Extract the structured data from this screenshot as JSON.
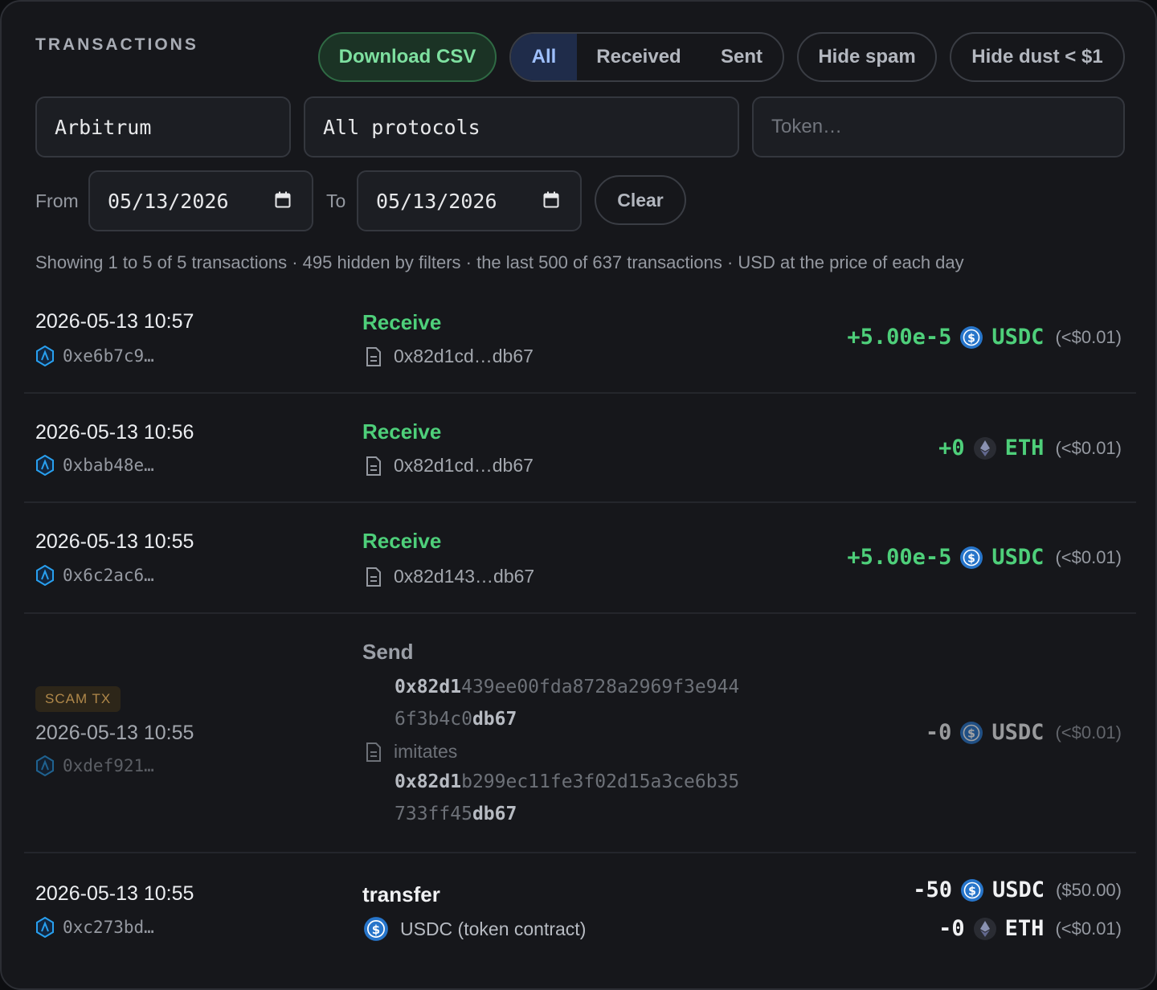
{
  "header": {
    "title": "TRANSACTIONS",
    "download_label": "Download CSV",
    "filter_tabs": [
      "All",
      "Received",
      "Sent"
    ],
    "hide_spam_label": "Hide spam",
    "hide_dust_label": "Hide dust < $1"
  },
  "filters": {
    "chain_value": "Arbitrum",
    "protocol_value": "All protocols",
    "token_placeholder": "Token…",
    "from_label": "From",
    "from_value": "05/13/2026",
    "to_label": "To",
    "to_value": "05/13/2026",
    "clear_label": "Clear"
  },
  "summary": "Showing 1 to 5 of 5 transactions · 495 hidden by filters · the last 500 of 637 transactions · USD at the price of each day",
  "colors": {
    "accent_green": "#4ecf7a",
    "accent_blue": "#9fc0ff",
    "scam": "#b0884a",
    "usdc": "#2775ca"
  },
  "transactions": [
    {
      "time": "2026-05-13 10:57",
      "hash": "0xe6b7c9…",
      "kind": "Receive",
      "counterparty": "0x82d1cd…db67",
      "amounts": [
        {
          "value": "+5.00e-5",
          "token": "USDC",
          "icon": "usdc-icon",
          "usd": "(<$0.01)"
        }
      ]
    },
    {
      "time": "2026-05-13 10:56",
      "hash": "0xbab48e…",
      "kind": "Receive",
      "counterparty": "0x82d1cd…db67",
      "amounts": [
        {
          "value": "+0",
          "token": "ETH",
          "icon": "eth-icon",
          "usd": "(<$0.01)"
        }
      ]
    },
    {
      "time": "2026-05-13 10:55",
      "hash": "0x6c2ac6…",
      "kind": "Receive",
      "counterparty": "0x82d143…db67",
      "amounts": [
        {
          "value": "+5.00e-5",
          "token": "USDC",
          "icon": "usdc-icon",
          "usd": "(<$0.01)"
        }
      ]
    },
    {
      "time": "2026-05-13 10:55",
      "hash": "0xdef921…",
      "kind": "Send",
      "badge": "SCAM TX",
      "scam_address": {
        "line1_bold": "0x82d1",
        "line1_rest": "439ee00fda8728a2969f3e944",
        "line2_rest": "6f3b4c0",
        "line2_bold": "db67"
      },
      "imitates_label": "imitates",
      "real_address": {
        "line1_bold": "0x82d1",
        "line1_rest": "b299ec11fe3f02d15a3ce6b35",
        "line2_rest": "733ff45",
        "line2_bold": "db67"
      },
      "amounts": [
        {
          "value": "-0",
          "token": "USDC",
          "icon": "usdc-icon",
          "usd": "(<$0.01)"
        }
      ]
    },
    {
      "time": "2026-05-13 10:55",
      "hash": "0xc273bd…",
      "kind": "transfer",
      "counterparty": "USDC (token contract)",
      "amounts": [
        {
          "value": "-50",
          "token": "USDC",
          "icon": "usdc-icon",
          "usd": "($50.00)"
        },
        {
          "value": "-0",
          "token": "ETH",
          "icon": "eth-icon",
          "usd": "(<$0.01)"
        }
      ]
    }
  ]
}
